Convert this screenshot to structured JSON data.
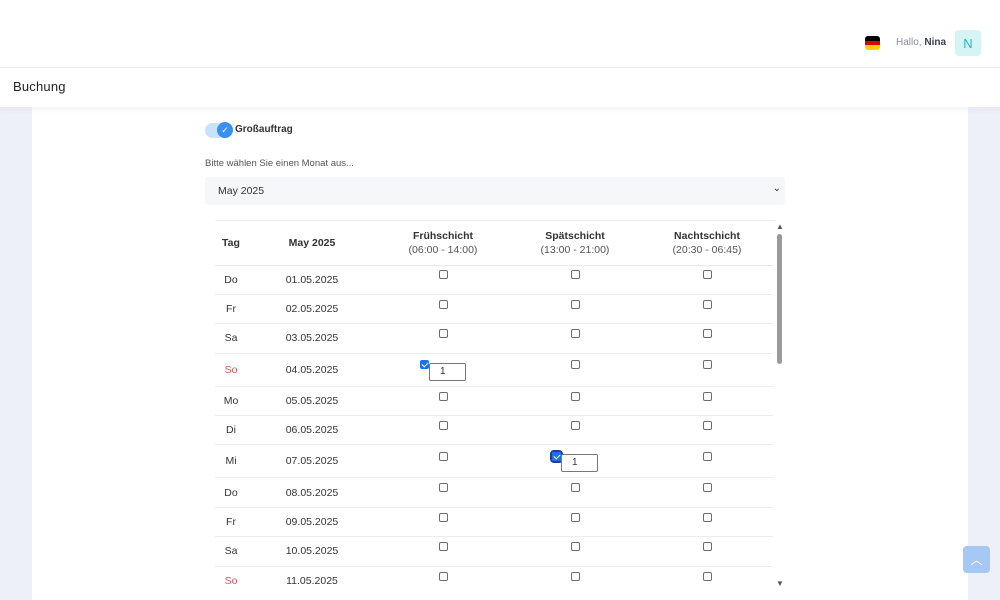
{
  "header": {
    "greeting": "Hallo,",
    "user_name": "Nina",
    "avatar_initial": "N",
    "flag_icon": "german-flag-icon",
    "flag_colors": [
      "#000000",
      "#dd0000",
      "#ffce00"
    ]
  },
  "page": {
    "title": "Buchung"
  },
  "form": {
    "toggle_label": "Großauftrag",
    "toggle_on": true,
    "month_prompt": "Bitte wählen Sie einen Monat aus...",
    "month_selected": "May 2025"
  },
  "table": {
    "headers": {
      "day": "Tag",
      "month": "May 2025",
      "early": {
        "name": "Frühschicht",
        "time": "(06:00 - 14:00)"
      },
      "late": {
        "name": "Spätschicht",
        "time": "(13:00 - 21:00)"
      },
      "night": {
        "name": "Nachtschicht",
        "time": "(20:30 - 06:45)"
      }
    },
    "rows": [
      {
        "day": "Do",
        "date": "01.05.2025",
        "sunday": false,
        "early": null,
        "late": null,
        "night": null
      },
      {
        "day": "Fr",
        "date": "02.05.2025",
        "sunday": false,
        "early": null,
        "late": null,
        "night": null
      },
      {
        "day": "Sa",
        "date": "03.05.2025",
        "sunday": false,
        "early": null,
        "late": null,
        "night": null
      },
      {
        "day": "So",
        "date": "04.05.2025",
        "sunday": true,
        "early": "1",
        "late": null,
        "night": null
      },
      {
        "day": "Mo",
        "date": "05.05.2025",
        "sunday": false,
        "early": null,
        "late": null,
        "night": null
      },
      {
        "day": "Di",
        "date": "06.05.2025",
        "sunday": false,
        "early": null,
        "late": null,
        "night": null
      },
      {
        "day": "Mi",
        "date": "07.05.2025",
        "sunday": false,
        "early": null,
        "late": "1",
        "night": null
      },
      {
        "day": "Do",
        "date": "08.05.2025",
        "sunday": false,
        "early": null,
        "late": null,
        "night": null
      },
      {
        "day": "Fr",
        "date": "09.05.2025",
        "sunday": false,
        "early": null,
        "late": null,
        "night": null
      },
      {
        "day": "Sa",
        "date": "10.05.2025",
        "sunday": false,
        "early": null,
        "late": null,
        "night": null
      },
      {
        "day": "So",
        "date": "11.05.2025",
        "sunday": true,
        "early": null,
        "late": null,
        "night": null
      }
    ]
  },
  "colors": {
    "accent": "#3a8ff0",
    "sunday": "#e04f5f",
    "avatar_bg": "#d5f4f6",
    "avatar_text": "#2bb7c3"
  }
}
